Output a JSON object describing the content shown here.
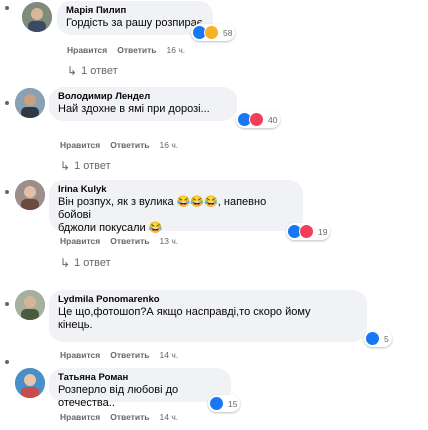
{
  "comments": [
    {
      "author": "Марія Пилип",
      "text": "Гордість за рашу розпирає",
      "like_label": "Нравится",
      "reply_label": "Ответить",
      "time": "16 ч.",
      "reactions": [
        "like",
        "angry"
      ],
      "reaction_count": "58",
      "replies": "1 ответ"
    },
    {
      "author": "Володимир Лендел",
      "text": "Най здохне в ямі при дорозі...",
      "like_label": "Нравится",
      "reply_label": "Ответить",
      "time": "16 ч.",
      "reactions": [
        "like",
        "love"
      ],
      "reaction_count": "40",
      "replies": "1 ответ"
    },
    {
      "author": "Irina Kulyk",
      "text_line1": "Він розпух, як з вулика 😂😂😂, напевно бойові",
      "text_line2": "бджоли покусали 😂",
      "like_label": "Нравится",
      "reply_label": "Ответить",
      "time": "13 ч.",
      "reactions": [
        "like",
        "love"
      ],
      "reaction_count": "19",
      "replies": "1 ответ"
    },
    {
      "author": "Lydmila Ponomarenko",
      "text_line1": "Це що,фотошоп?А якщо насправді,то скоро йому",
      "text_line2": "кінець.",
      "like_label": "Нравится",
      "reply_label": "Ответить",
      "time": "14 ч.",
      "reactions": [
        "like"
      ],
      "reaction_count": "5"
    },
    {
      "author": "Татьяна Роман",
      "text": "Розперло від любові до отечества..",
      "like_label": "Нравится",
      "reply_label": "Ответить",
      "time": "14 ч.",
      "reactions": [
        "like"
      ],
      "reaction_count": "15"
    }
  ],
  "colors": {
    "bubble": "#f0f2f5",
    "meta": "#65676b",
    "like": "#1877f2",
    "love": "#f33e58",
    "haha": "#f7b125"
  }
}
